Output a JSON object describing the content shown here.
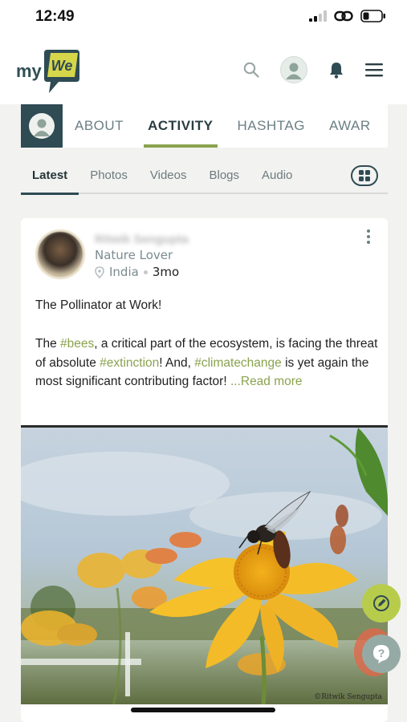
{
  "status_bar": {
    "time": "12:49"
  },
  "app": {
    "logo_left": "my",
    "logo_right": "We"
  },
  "profile_tabs": [
    "ABOUT",
    "ACTIVITY",
    "HASHTAG",
    "AWAR"
  ],
  "sub_tabs": [
    "Latest",
    "Photos",
    "Videos",
    "Blogs",
    "Audio"
  ],
  "post": {
    "author": "Ritwik Sengupta",
    "tagline": "Nature Lover",
    "location": "India",
    "age": "3mo",
    "title": "The Pollinator at Work!",
    "body": {
      "p1": "The ",
      "tag1": "#bees",
      "p2": ", a critical part of the ecosystem, is facing the threat of absolute ",
      "tag2": "#extinction",
      "p3": "! And, ",
      "tag3": "#climatechange",
      "p4": " is yet again the most significant contributing factor! ",
      "read_more": "...Read more"
    },
    "image_credit": "©Ritwik Sengupta"
  },
  "colors": {
    "accent_green": "#8aa34e",
    "teal_dark": "#2f4b54",
    "fab_edit": "#b8cc4c",
    "fab_help": "#96aaa5"
  },
  "icons": [
    "search-icon",
    "user-avatar-icon",
    "bell-icon",
    "hamburger-menu-icon",
    "grid-icon",
    "location-pin-icon",
    "more-vertical-icon",
    "edit-icon",
    "help-icon"
  ]
}
